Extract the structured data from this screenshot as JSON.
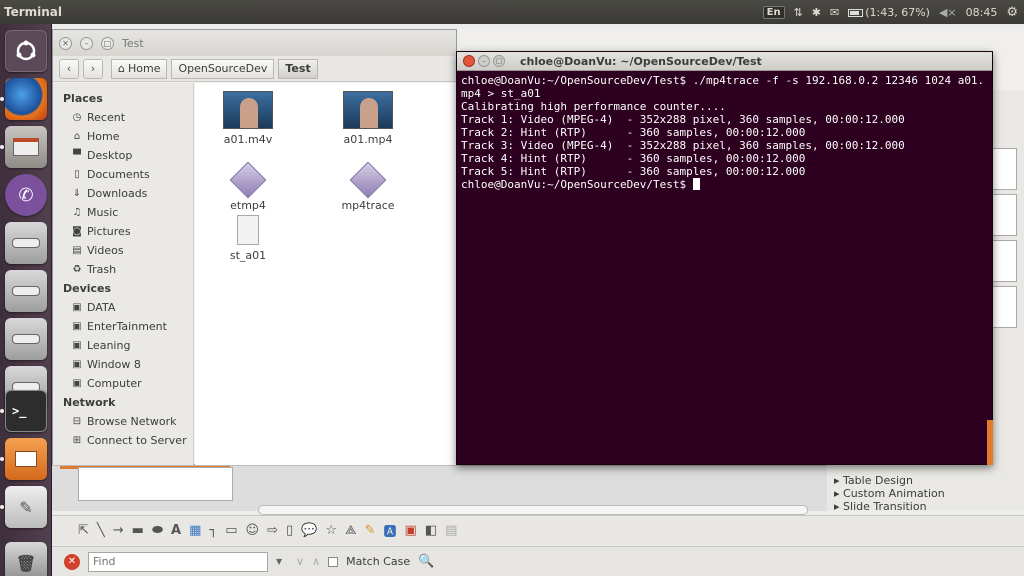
{
  "top_panel": {
    "app_title": "Terminal",
    "keyboard_layout": "En",
    "battery_text": "(1:43, 67%)",
    "volume_glyph": "◀×",
    "clock": "08:45",
    "icons": [
      "network-updown-icon",
      "bluetooth-icon",
      "mail-icon",
      "battery-icon",
      "volume-icon",
      "settings-gear-icon"
    ]
  },
  "launcher": {
    "items": [
      "dash-home-icon",
      "firefox-icon",
      "files-icon",
      "viber-icon",
      "drive-icon",
      "drive-icon",
      "drive-icon",
      "drive-icon",
      "terminal-icon",
      "impress-icon",
      "text-editor-icon",
      "trash-icon"
    ]
  },
  "files": {
    "window_title": "Test",
    "breadcrumbs": [
      "Home",
      "OpenSourceDev",
      "Test"
    ],
    "sidebar": {
      "places_header": "Places",
      "places": [
        {
          "label": "Recent",
          "icon": "clock-icon"
        },
        {
          "label": "Home",
          "icon": "home-icon"
        },
        {
          "label": "Desktop",
          "icon": "desktop-icon"
        },
        {
          "label": "Documents",
          "icon": "document-icon"
        },
        {
          "label": "Downloads",
          "icon": "download-icon"
        },
        {
          "label": "Music",
          "icon": "music-icon"
        },
        {
          "label": "Pictures",
          "icon": "camera-icon"
        },
        {
          "label": "Videos",
          "icon": "film-icon"
        },
        {
          "label": "Trash",
          "icon": "trash-icon"
        }
      ],
      "devices_header": "Devices",
      "devices": [
        "DATA",
        "EnterTainment",
        "Leaning",
        "Window 8",
        "Computer"
      ],
      "network_header": "Network",
      "network": [
        {
          "label": "Browse Network",
          "icon": "network-icon"
        },
        {
          "label": "Connect to Server",
          "icon": "server-icon"
        }
      ]
    },
    "files": [
      {
        "name": "a01.m4v",
        "kind": "video"
      },
      {
        "name": "a01.mp4",
        "kind": "video"
      },
      {
        "name": "etmp4",
        "kind": "exec"
      },
      {
        "name": "mp4trace",
        "kind": "exec"
      },
      {
        "name": "st_a01",
        "kind": "text"
      }
    ]
  },
  "terminal": {
    "title": "chloe@DoanVu: ~/OpenSourceDev/Test",
    "lines": [
      "chloe@DoanVu:~/OpenSourceDev/Test$ ./mp4trace -f -s 192.168.0.2 12346 1024 a01.",
      "mp4 > st_a01",
      "Calibrating high performance counter....",
      "Track 1: Video (MPEG-4)  - 352x288 pixel, 360 samples, 00:00:12.000",
      "Track 2: Hint (RTP)      - 360 samples, 00:00:12.000",
      "Track 3: Video (MPEG-4)  - 352x288 pixel, 360 samples, 00:00:12.000",
      "Track 4: Hint (RTP)      - 360 samples, 00:00:12.000",
      "Track 5: Hint (RTP)      - 360 samples, 00:00:12.000"
    ],
    "prompt": "chloe@DoanVu:~/OpenSourceDev/Test$ "
  },
  "impress": {
    "tasks": [
      "Table Design",
      "Custom Animation",
      "Slide Transition"
    ],
    "find_placeholder": "Find",
    "match_case": "Match Case"
  }
}
